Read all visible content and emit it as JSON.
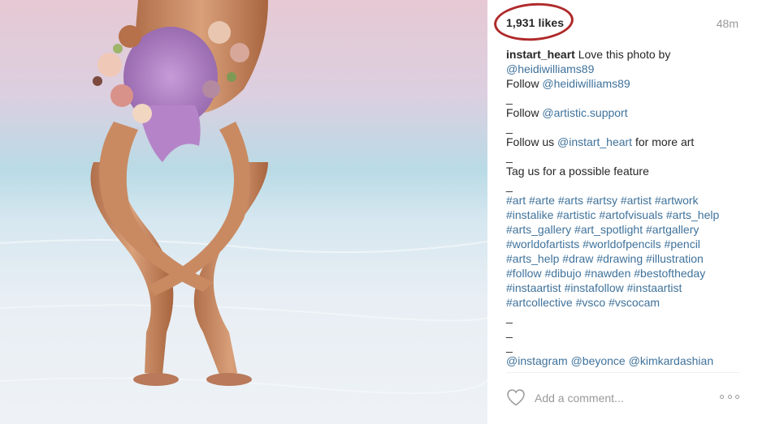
{
  "post": {
    "likes": "1,931 likes",
    "time": "48m",
    "caption_lines": [
      [
        {
          "t": "instart_heart",
          "k": "uname"
        },
        {
          "t": " Love this photo by"
        }
      ],
      [
        {
          "t": "@heidiwilliams89",
          "k": "link"
        }
      ],
      [
        {
          "t": "Follow "
        },
        {
          "t": "@heidiwilliams89",
          "k": "link"
        }
      ],
      [
        {
          "t": "_"
        }
      ],
      [
        {
          "t": "Follow "
        },
        {
          "t": "@artistic.support",
          "k": "link"
        }
      ],
      [
        {
          "t": "_"
        }
      ],
      [
        {
          "t": "Follow us "
        },
        {
          "t": "@instart_heart",
          "k": "link"
        },
        {
          "t": " for more art"
        }
      ],
      [
        {
          "t": "_"
        }
      ],
      [
        {
          "t": "Tag us for a possible feature"
        }
      ],
      [
        {
          "t": "_"
        }
      ],
      [
        {
          "t": "#art",
          "k": "link"
        },
        {
          "t": " "
        },
        {
          "t": "#arte",
          "k": "link"
        },
        {
          "t": " "
        },
        {
          "t": "#arts",
          "k": "link"
        },
        {
          "t": " "
        },
        {
          "t": "#artsy",
          "k": "link"
        },
        {
          "t": " "
        },
        {
          "t": "#artist",
          "k": "link"
        },
        {
          "t": " "
        },
        {
          "t": "#artwork",
          "k": "link"
        }
      ],
      [
        {
          "t": "#instalike",
          "k": "link"
        },
        {
          "t": " "
        },
        {
          "t": "#artistic",
          "k": "link"
        },
        {
          "t": " "
        },
        {
          "t": "#artofvisuals",
          "k": "link"
        },
        {
          "t": " "
        },
        {
          "t": "#arts_help",
          "k": "link"
        }
      ],
      [
        {
          "t": "#arts_gallery",
          "k": "link"
        },
        {
          "t": " "
        },
        {
          "t": "#art_spotlight",
          "k": "link"
        },
        {
          "t": " "
        },
        {
          "t": "#artgallery",
          "k": "link"
        }
      ],
      [
        {
          "t": "#worldofartists",
          "k": "link"
        },
        {
          "t": " "
        },
        {
          "t": "#worldofpencils",
          "k": "link"
        },
        {
          "t": " "
        },
        {
          "t": "#pencil",
          "k": "link"
        }
      ],
      [
        {
          "t": "#arts_help",
          "k": "link"
        },
        {
          "t": " "
        },
        {
          "t": "#draw",
          "k": "link"
        },
        {
          "t": " "
        },
        {
          "t": "#drawing",
          "k": "link"
        },
        {
          "t": " "
        },
        {
          "t": "#illustration",
          "k": "link"
        }
      ],
      [
        {
          "t": "#follow",
          "k": "link"
        },
        {
          "t": " "
        },
        {
          "t": "#dibujo",
          "k": "link"
        },
        {
          "t": " "
        },
        {
          "t": "#nawden",
          "k": "link"
        },
        {
          "t": " "
        },
        {
          "t": "#bestoftheday",
          "k": "link"
        }
      ],
      [
        {
          "t": "#instaartist",
          "k": "link"
        },
        {
          "t": " "
        },
        {
          "t": "#instafollow",
          "k": "link"
        },
        {
          "t": " "
        },
        {
          "t": "#instaartist",
          "k": "link"
        }
      ],
      [
        {
          "t": "#artcollective",
          "k": "link"
        },
        {
          "t": " "
        },
        {
          "t": "#vsco",
          "k": "link"
        },
        {
          "t": " "
        },
        {
          "t": "#vscocam",
          "k": "link"
        }
      ],
      [
        {
          "t": "_"
        }
      ],
      [
        {
          "t": "_"
        }
      ],
      [
        {
          "t": "_"
        }
      ],
      [
        {
          "t": "@instagram",
          "k": "link"
        },
        {
          "t": " "
        },
        {
          "t": "@beyonce",
          "k": "link"
        },
        {
          "t": " "
        },
        {
          "t": "@kimkardashian",
          "k": "link"
        }
      ]
    ]
  },
  "comment": {
    "placeholder": "Add a comment..."
  },
  "icons": {
    "like": "heart-outline-icon",
    "more": "ellipsis-icon"
  },
  "colors": {
    "link": "#3f729b",
    "highlight_circle": "#b0292a",
    "muted": "#999999"
  }
}
